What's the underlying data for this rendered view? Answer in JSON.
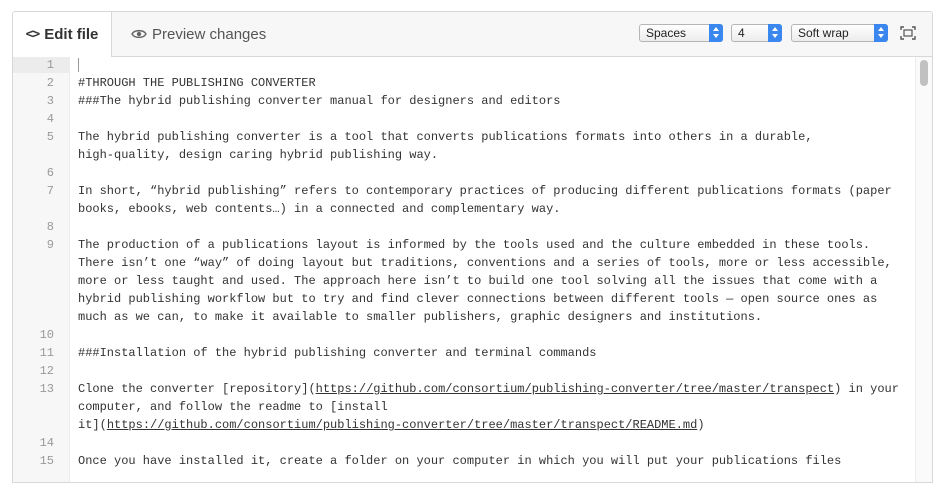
{
  "toolbar": {
    "edit_tab": "Edit file",
    "preview_tab": "Preview changes",
    "indent_mode": "Spaces",
    "indent_size": "4",
    "wrap_mode": "Soft wrap"
  },
  "editor": {
    "line_numbers": [
      "1",
      "2",
      "3",
      "4",
      "5",
      "6",
      "7",
      "8",
      "9",
      "10",
      "11",
      "12",
      "13",
      "14",
      "15"
    ],
    "lines": [
      "",
      "#THROUGH THE PUBLISHING CONVERTER",
      "###The hybrid publishing converter manual for designers and editors",
      "",
      "The hybrid publishing converter is a tool that converts publications formats into others in a durable,",
      "high-quality, design caring hybrid publishing way.",
      "",
      "In short, “hybrid publishing” refers to contemporary practices of producing different publications formats (paper",
      "books, ebooks, web contents…) in a connected and complementary way.",
      "",
      "The production of a publications layout is informed by the tools used and the culture embedded in these tools.",
      "There isn’t one “way” of doing layout but traditions, conventions and a series of tools, more or less accessible,",
      "more or less taught and used. The approach here isn’t to build one tool solving all the issues that come with a",
      "hybrid publishing workflow but to try and find clever connections between different tools — open source ones as",
      "much as we can, to make it available to smaller publishers, graphic designers and institutions.",
      "",
      "###Installation of the hybrid publishing converter and terminal commands",
      "",
      "Clone the converter [",
      "repository",
      "](",
      "https://github.com/consortium/publishing-converter/tree/master/transpect",
      ") in your",
      "computer, and follow the readme to [",
      "install",
      "it](",
      "https://github.com/consortium/publishing-converter/tree/master/transpect/README.md",
      ")",
      "",
      "Once you have installed it, create a folder on your computer in which you will put your publications files"
    ]
  }
}
